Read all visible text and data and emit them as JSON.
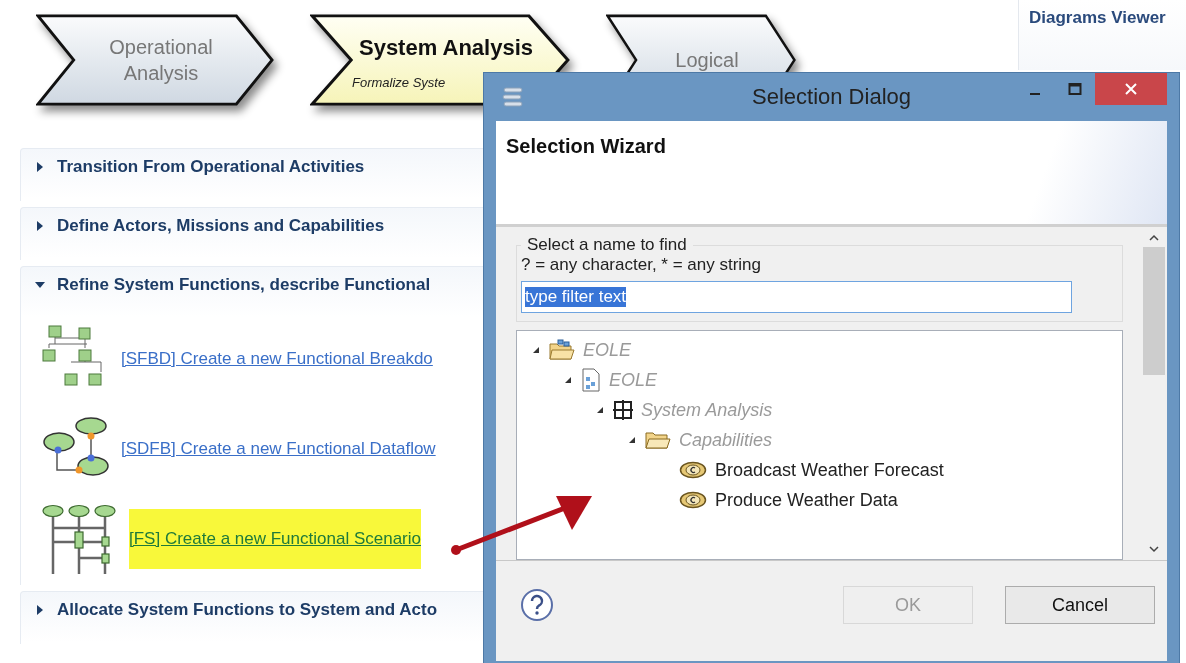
{
  "process_steps": [
    {
      "title": "Operational Analysis",
      "selected": false
    },
    {
      "title": "System Analysis",
      "subtitle": "Formalize Syste",
      "selected": true
    },
    {
      "title": "Logical",
      "selected": false
    }
  ],
  "side_panel": {
    "title": "Diagrams Viewer"
  },
  "sections": [
    {
      "title": "Transition From Operational Activities",
      "expanded": false
    },
    {
      "title": "Define Actors, Missions and Capabilities",
      "expanded": false
    },
    {
      "title": "Refine System Functions, describe Functional",
      "expanded": true,
      "items": [
        {
          "kind": "breakdown",
          "label": "[SFBD] Create a new Functional Breakdo",
          "highlighted": false
        },
        {
          "kind": "dataflow",
          "label": "[SDFB] Create a new Functional Dataflow",
          "highlighted": false
        },
        {
          "kind": "scenario",
          "label": "[FS] Create a new Functional Scenario",
          "highlighted": true
        }
      ]
    },
    {
      "title": "Allocate System Functions to System and  Acto",
      "expanded": false
    }
  ],
  "dialog": {
    "title": "Selection Dialog",
    "wizard_title": "Selection Wizard",
    "group_label": "Select a name to find",
    "hint": "? = any character, * = any string",
    "filter": {
      "value": "type filter text",
      "text_selected": true
    },
    "tree": [
      {
        "kind": "project",
        "label": "EOLE",
        "greyed": true,
        "expanded": true,
        "children": [
          {
            "kind": "model",
            "label": "EOLE",
            "greyed": true,
            "expanded": true,
            "children": [
              {
                "kind": "layer",
                "label": "System Analysis",
                "greyed": true,
                "expanded": true,
                "children": [
                  {
                    "kind": "folder",
                    "label": "Capabilities",
                    "greyed": true,
                    "expanded": true,
                    "children": [
                      {
                        "kind": "capability",
                        "label": "Broadcast Weather Forecast",
                        "greyed": false
                      },
                      {
                        "kind": "capability",
                        "label": "Produce Weather Data",
                        "greyed": false
                      }
                    ]
                  }
                ]
              }
            ]
          }
        ]
      }
    ],
    "buttons": [
      {
        "label": "OK",
        "disabled": true
      },
      {
        "label": "Cancel",
        "disabled": false
      }
    ]
  }
}
